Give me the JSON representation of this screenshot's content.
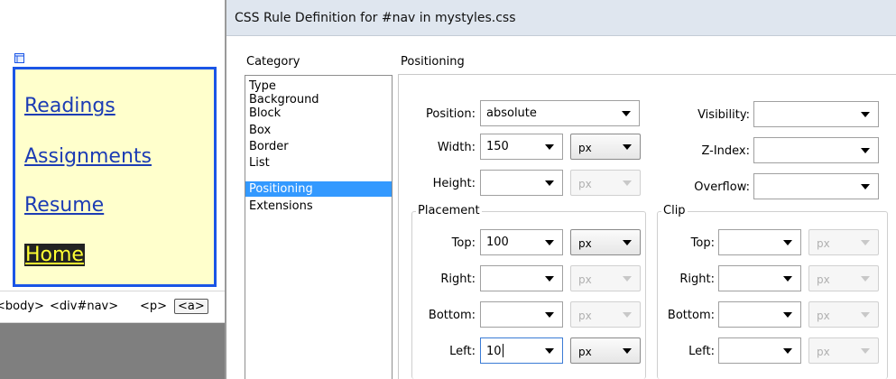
{
  "design_view": {
    "nav_links": [
      "Readings",
      "Assignments",
      "Resume",
      "Home"
    ],
    "tag_selector": {
      "tags": [
        "<body>",
        "<div#nav>",
        "<p>"
      ],
      "selected_tag": "<a>"
    }
  },
  "dialog": {
    "title": "CSS Rule Definition for #nav in mystyles.css",
    "category_header": "Category",
    "categories": [
      "Type",
      "Background",
      "Block",
      "Box",
      "Border",
      "List",
      "Positioning",
      "Extensions"
    ],
    "selected_category": "Positioning",
    "section_title": "Positioning",
    "fields": {
      "position": {
        "label": "Position:",
        "value": "absolute"
      },
      "width": {
        "label": "Width:",
        "value": "150",
        "unit": "px"
      },
      "height": {
        "label": "Height:",
        "value": "",
        "unit": "px"
      },
      "visibility": {
        "label": "Visibility:",
        "value": ""
      },
      "z_index": {
        "label": "Z-Index:",
        "value": ""
      },
      "overflow": {
        "label": "Overflow:",
        "value": ""
      }
    },
    "placement": {
      "legend": "Placement",
      "top": {
        "label": "Top:",
        "value": "100",
        "unit": "px"
      },
      "right": {
        "label": "Right:",
        "value": "",
        "unit": "px"
      },
      "bottom": {
        "label": "Bottom:",
        "value": "",
        "unit": "px"
      },
      "left": {
        "label": "Left:",
        "value": "10",
        "unit": "px"
      }
    },
    "clip": {
      "legend": "Clip",
      "top": {
        "label": "Top:",
        "value": "",
        "unit": "px"
      },
      "right": {
        "label": "Right:",
        "value": "",
        "unit": "px"
      },
      "bottom": {
        "label": "Bottom:",
        "value": "",
        "unit": "px"
      },
      "left": {
        "label": "Left:",
        "value": "",
        "unit": "px"
      }
    }
  },
  "colors": {
    "nav_background": "#ffffcc",
    "nav_border": "#1a55e6",
    "link": "#1c3cb4",
    "selection": "#3399ff"
  },
  "icons": [
    "anchor-marker-icon",
    "dropdown-arrow-icon"
  ]
}
